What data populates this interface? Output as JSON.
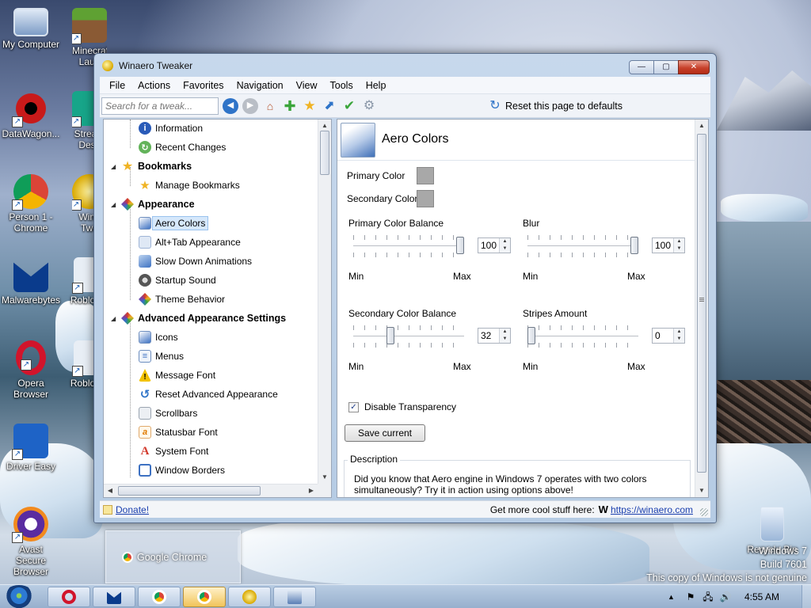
{
  "desktop": {
    "icons": [
      {
        "name": "my-computer",
        "label": "My Computer",
        "icon": "computer-icon"
      },
      {
        "name": "minecraft",
        "label": "Minecraft Laun",
        "icon": "minecraft-icon"
      },
      {
        "name": "datawagon",
        "label": "DataWagon...",
        "icon": "datawagon-icon"
      },
      {
        "name": "stream",
        "label": "Stream Desk",
        "icon": "stream-icon"
      },
      {
        "name": "person1-chrome",
        "label": "Person 1 - Chrome",
        "icon": "chrome-icon"
      },
      {
        "name": "winaero",
        "label": "Wina Twe",
        "icon": "winaero-icon"
      },
      {
        "name": "malwarebytes",
        "label": "Malwarebytes",
        "icon": "malwarebytes-icon"
      },
      {
        "name": "roblox1",
        "label": "Roblox",
        "icon": "roblox-icon"
      },
      {
        "name": "opera",
        "label": "Opera Browser",
        "icon": "opera-icon"
      },
      {
        "name": "roblox2",
        "label": "Roblox",
        "icon": "roblox-icon"
      },
      {
        "name": "driver-easy",
        "label": "Driver Easy",
        "icon": "drivereasy-icon"
      },
      {
        "name": "avast",
        "label": "Avast Secure Browser",
        "icon": "avast-icon"
      },
      {
        "name": "recycle-bin",
        "label": "Recycle Bin",
        "icon": "recycle-bin-icon"
      }
    ],
    "watermark": {
      "line1": "Windows 7",
      "line2": "Build 7601",
      "line3": "This copy of Windows is not genuine"
    }
  },
  "window": {
    "title": "Winaero Tweaker",
    "controls": {
      "minimize": "—",
      "maximize": "▢",
      "close": "✕"
    },
    "menu": [
      "File",
      "Actions",
      "Favorites",
      "Navigation",
      "View",
      "Tools",
      "Help"
    ],
    "search": {
      "placeholder": "Search for a tweak...",
      "value": ""
    },
    "toolbar": {
      "reset_label": "Reset this page to defaults"
    },
    "tree": [
      {
        "label": "Information",
        "level": 2,
        "icon": "info-icon",
        "color": "#2a5bb8",
        "glyph": "i"
      },
      {
        "label": "Recent Changes",
        "level": 2,
        "icon": "recent-changes-icon",
        "color": "#63b35a",
        "glyph": "↻"
      },
      {
        "label": "Bookmarks",
        "level": 1,
        "icon": "bookmarks-star-icon",
        "color": "#f0b323",
        "glyph": "★"
      },
      {
        "label": "Manage Bookmarks",
        "level": 2,
        "icon": "manage-bookmarks-icon",
        "color": "#f0b323",
        "glyph": "★"
      },
      {
        "label": "Appearance",
        "level": 1,
        "icon": "appearance-icon",
        "color": "#7b3fa6",
        "glyph": "◆"
      },
      {
        "label": "Aero Colors",
        "level": 2,
        "icon": "aero-colors-icon",
        "color": "#3d71c2",
        "glyph": "▮",
        "selected": true
      },
      {
        "label": "Alt+Tab Appearance",
        "level": 2,
        "icon": "alt-tab-icon",
        "color": "#9fb4d6",
        "glyph": "▭"
      },
      {
        "label": "Slow Down Animations",
        "level": 2,
        "icon": "animations-icon",
        "color": "#3d71c2",
        "glyph": "▭"
      },
      {
        "label": "Startup Sound",
        "level": 2,
        "icon": "startup-sound-icon",
        "color": "#555",
        "glyph": "◉"
      },
      {
        "label": "Theme Behavior",
        "level": 2,
        "icon": "theme-behavior-icon",
        "color": "#7b3fa6",
        "glyph": "◆"
      },
      {
        "label": "Advanced Appearance Settings",
        "level": 1,
        "icon": "advanced-appearance-icon",
        "color": "#7b3fa6",
        "glyph": "◆"
      },
      {
        "label": "Icons",
        "level": 2,
        "icon": "icons-icon",
        "color": "#3d71c2",
        "glyph": "▣"
      },
      {
        "label": "Menus",
        "level": 2,
        "icon": "menus-icon",
        "color": "#6e8fbf",
        "glyph": "≡"
      },
      {
        "label": "Message Font",
        "level": 2,
        "icon": "warning-icon",
        "color": "#e1b100",
        "glyph": "!"
      },
      {
        "label": "Reset Advanced Appearance",
        "level": 2,
        "icon": "reset-icon",
        "color": "#2f74c8",
        "glyph": "↺"
      },
      {
        "label": "Scrollbars",
        "level": 2,
        "icon": "scrollbars-icon",
        "color": "#9aa4b0",
        "glyph": "▥"
      },
      {
        "label": "Statusbar Font",
        "level": 2,
        "icon": "statusbar-font-icon",
        "color": "#e07b00",
        "glyph": "a"
      },
      {
        "label": "System Font",
        "level": 2,
        "icon": "system-font-icon",
        "color": "#d23b2e",
        "glyph": "A"
      },
      {
        "label": "Window Borders",
        "level": 2,
        "icon": "window-borders-icon",
        "color": "#3d71c2",
        "glyph": "▢"
      }
    ],
    "content": {
      "title": "Aero Colors",
      "primary_color_label": "Primary Color",
      "secondary_color_label": "Secondary Color",
      "sliders": {
        "primary_balance": {
          "label": "Primary Color Balance",
          "value": 100,
          "min_label": "Min",
          "max_label": "Max",
          "fraction": 1.0
        },
        "blur": {
          "label": "Blur",
          "value": 100,
          "min_label": "Min",
          "max_label": "Max",
          "fraction": 1.0
        },
        "secondary_balance": {
          "label": "Secondary Color Balance",
          "value": 32,
          "min_label": "Min",
          "max_label": "Max",
          "fraction": 0.32
        },
        "stripes": {
          "label": "Stripes Amount",
          "value": 0,
          "min_label": "Min",
          "max_label": "Max",
          "fraction": 0.0
        }
      },
      "checkbox": {
        "label": "Disable Transparency",
        "checked": true
      },
      "save_button": "Save current",
      "description": {
        "legend": "Description",
        "text": "Did you know that Aero engine in Windows 7 operates with two colors simultaneously? Try it in action using options above!"
      }
    },
    "statusbar": {
      "donate": "Donate!",
      "more_text": "Get more cool stuff here:",
      "w_glyph": "W",
      "link": "https://winaero.com"
    }
  },
  "taskbar": {
    "preview_label": "Google Chrome",
    "buttons": [
      {
        "name": "opera",
        "icon": "opera-icon",
        "color": "#d1142b"
      },
      {
        "name": "malwarebytes",
        "icon": "malwarebytes-icon",
        "color": "#0a3b8c"
      },
      {
        "name": "chrome",
        "icon": "chrome-icon",
        "color": "#db4437"
      },
      {
        "name": "chrome-active",
        "icon": "chrome-icon",
        "color": "#db4437",
        "active": true
      },
      {
        "name": "winaero",
        "icon": "winaero-icon",
        "color": "#d9a800"
      },
      {
        "name": "control-panel",
        "icon": "control-panel-icon",
        "color": "#5a7fb5"
      }
    ],
    "clock": "4:55 AM"
  }
}
